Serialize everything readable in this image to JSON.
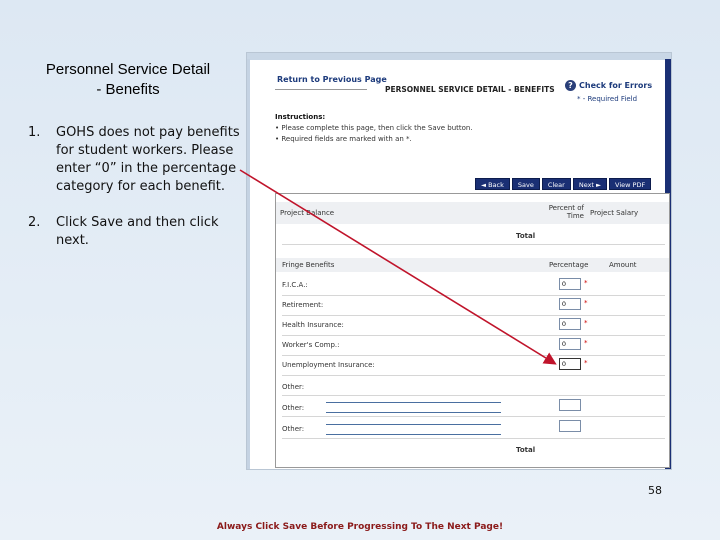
{
  "slide": {
    "title_line1": "Personnel Service Detail",
    "title_line2": "- Benefits",
    "steps": [
      {
        "num": "1.",
        "text": "GOHS does not pay benefits for student workers. Please enter “0” in the percentage category for each benefit."
      },
      {
        "num": "2.",
        "text": "Click  Save  and then click next."
      }
    ],
    "page_number": "58",
    "footer": "Always Click Save Before Progressing To The Next Page!"
  },
  "screenshot": {
    "return_link": "Return to Previous Page",
    "heading": "PERSONNEL SERVICE DETAIL - BENEFITS",
    "check_errors": "Check for Errors",
    "required_note": "* - Required Field",
    "instructions_title": "Instructions:",
    "instructions": [
      "•  Please complete this page, then click the Save button.",
      "•  Required fields are marked with an *."
    ],
    "toolbar": {
      "back": "◄ Back",
      "save": "Save",
      "clear": "Clear",
      "next": "Next ►",
      "view_pdf": "View PDF"
    },
    "project_balance": {
      "label": "Project Balance",
      "percent_of_time": "Percent of Time",
      "project_salary": "Project Salary",
      "total_label": "Total"
    },
    "fringe": {
      "header": "Fringe Benefits",
      "percentage_header": "Percentage",
      "amount_header": "Amount",
      "required_mark": "*",
      "rows": [
        {
          "label": "F.I.C.A.:",
          "value": "0"
        },
        {
          "label": "Retirement:",
          "value": "0"
        },
        {
          "label": "Health Insurance:",
          "value": "0"
        },
        {
          "label": "Worker's Comp.:",
          "value": "0"
        },
        {
          "label": "Unemployment Insurance:",
          "value": "0"
        }
      ],
      "others": [
        "Other:",
        "Other:",
        "Other:"
      ],
      "total_label": "Total"
    }
  },
  "colors": {
    "arrow": "#c0142b",
    "nav_dark": "#1a2f74",
    "footer": "#8b1a1a"
  }
}
